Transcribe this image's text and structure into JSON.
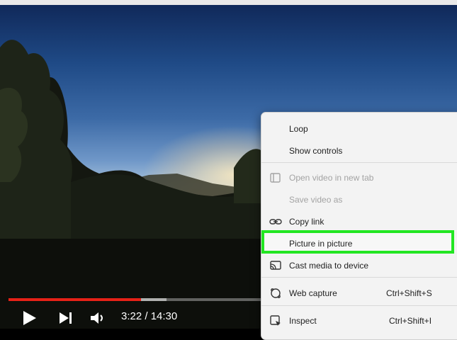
{
  "player": {
    "time_display": "3:22 / 14:30",
    "progress": 0.52,
    "buffered": 0.62,
    "colors": {
      "progress": "#e62117"
    },
    "icons": [
      "play-icon",
      "next-icon",
      "volume-icon"
    ]
  },
  "context_menu": {
    "items": [
      {
        "label": "Loop",
        "shortcut": "",
        "icon": "",
        "disabled": false
      },
      {
        "label": "Show controls",
        "shortcut": "",
        "icon": "",
        "disabled": false
      },
      {
        "label": "Open video in new tab",
        "shortcut": "",
        "icon": "new-tab-icon",
        "disabled": true
      },
      {
        "label": "Save video as",
        "shortcut": "",
        "icon": "",
        "disabled": true
      },
      {
        "label": "Copy link",
        "shortcut": "",
        "icon": "link-icon",
        "disabled": false
      },
      {
        "label": "Picture in picture",
        "shortcut": "",
        "icon": "",
        "disabled": false,
        "highlighted": true
      },
      {
        "label": "Cast media to device",
        "shortcut": "",
        "icon": "cast-icon",
        "disabled": false
      },
      {
        "label": "Web capture",
        "shortcut": "Ctrl+Shift+S",
        "icon": "web-capture-icon",
        "disabled": false
      },
      {
        "label": "Inspect",
        "shortcut": "Ctrl+Shift+I",
        "icon": "inspect-icon",
        "disabled": false
      }
    ],
    "colors": {
      "highlight_border": "#22e622"
    }
  }
}
